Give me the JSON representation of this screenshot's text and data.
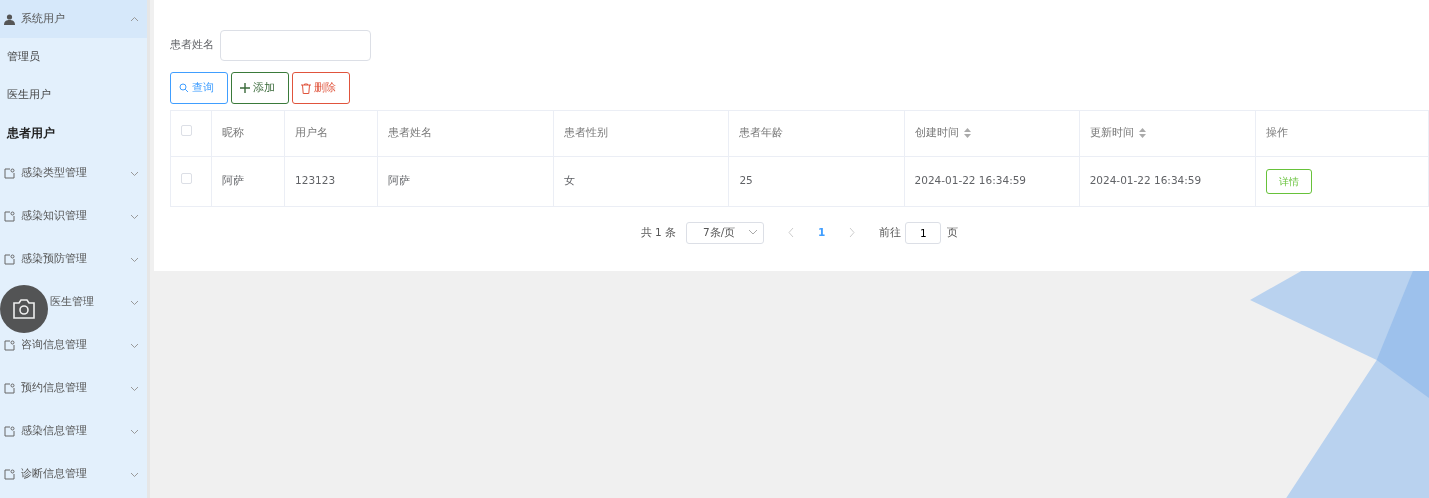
{
  "sidebar": {
    "items": [
      {
        "kind": "group",
        "label": "系统用户",
        "expanded": true,
        "children": [
          {
            "label": "管理员",
            "selected": false
          },
          {
            "label": "医生用户",
            "selected": false
          },
          {
            "label": "患者用户",
            "selected": true
          }
        ]
      },
      {
        "kind": "group",
        "label": "感染类型管理",
        "expanded": false
      },
      {
        "kind": "group",
        "label": "感染知识管理",
        "expanded": false
      },
      {
        "kind": "group",
        "label": "感染预防管理",
        "expanded": false
      },
      {
        "kind": "covered",
        "label": "医生管理",
        "expanded": false
      },
      {
        "kind": "group",
        "label": "咨询信息管理",
        "expanded": false
      },
      {
        "kind": "group",
        "label": "预约信息管理",
        "expanded": false
      },
      {
        "kind": "group",
        "label": "感染信息管理",
        "expanded": false
      },
      {
        "kind": "group",
        "label": "诊断信息管理",
        "expanded": false
      }
    ]
  },
  "search": {
    "label": "患者姓名"
  },
  "buttons": [
    {
      "kind": "search",
      "label": "查询"
    },
    {
      "kind": "add",
      "label": "添加"
    },
    {
      "kind": "delete",
      "label": "删除"
    }
  ],
  "table": {
    "header_checked": false,
    "columns": [
      {
        "label": "昵称",
        "sortable": false
      },
      {
        "label": "用户名",
        "sortable": false
      },
      {
        "label": "患者姓名",
        "sortable": false
      },
      {
        "label": "患者性别",
        "sortable": false
      },
      {
        "label": "患者年龄",
        "sortable": false
      },
      {
        "label": "创建时间",
        "sortable": true
      },
      {
        "label": "更新时间",
        "sortable": true
      },
      {
        "label": "操作",
        "sortable": false
      }
    ],
    "rows": [
      {
        "checked": false,
        "cells": [
          "阿萨",
          "123123",
          "阿萨",
          "女",
          "25",
          "2024-01-22 16:34:59",
          "2024-01-22 16:34:59"
        ],
        "action": "详情"
      }
    ]
  },
  "pagination": {
    "total": "共 1 条",
    "page_size": "7条/页",
    "pages": [
      {
        "label": "1",
        "selected": true
      }
    ],
    "goto_label": "前往",
    "goto_value": "1",
    "goto_suffix": "页"
  }
}
